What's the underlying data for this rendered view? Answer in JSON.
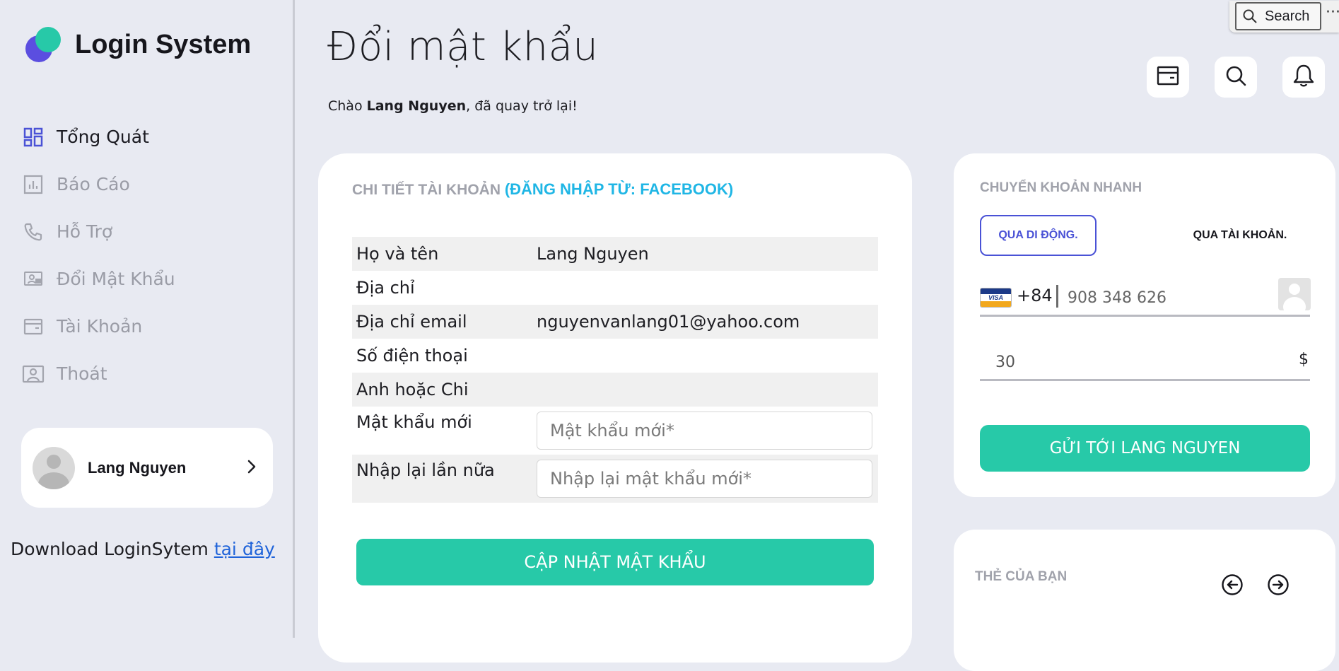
{
  "brand": {
    "name": "Login System"
  },
  "sidebar": {
    "items": [
      {
        "label": "Tổng Quát",
        "icon": "dashboard-icon",
        "active": true
      },
      {
        "label": "Báo Cáo",
        "icon": "report-icon",
        "active": false
      },
      {
        "label": "Hỗ Trợ",
        "icon": "phone-icon",
        "active": false
      },
      {
        "label": "Đổi Mật Khẩu",
        "icon": "change-password-icon",
        "active": false
      },
      {
        "label": "Tài Khoản",
        "icon": "wallet-icon",
        "active": false
      },
      {
        "label": "Thoát",
        "icon": "logout-icon",
        "active": false
      }
    ],
    "profile": {
      "name": "Lang Nguyen"
    },
    "download": {
      "text": "Download LoginSytem ",
      "link": "tại đây"
    }
  },
  "header": {
    "title": "Đổi mật khẩu",
    "welcome_prefix": "Chào ",
    "welcome_name": "Lang Nguyen",
    "welcome_suffix": ", đã quay trở lại!",
    "search": {
      "label": "Search",
      "more": "···"
    }
  },
  "account": {
    "title": "CHI TIẾT TÀI KHOẢN ",
    "source": "(ĐĂNG NHẬP TỪ: FACEBOOK)",
    "rows": [
      {
        "label": "Họ và tên",
        "value": "Lang Nguyen"
      },
      {
        "label": "Địa chỉ",
        "value": ""
      },
      {
        "label": "Địa chỉ email",
        "value": "nguyenvanlang01@yahoo.com"
      },
      {
        "label": "Số điện thoại",
        "value": ""
      },
      {
        "label": "Anh hoặc Chi",
        "value": ""
      }
    ],
    "new_password": {
      "label": "Mật khẩu mới",
      "placeholder": "Mật khẩu mới*"
    },
    "confirm_password": {
      "label": "Nhập lại lần nữa",
      "placeholder": "Nhập lại mật khẩu mới*"
    },
    "update_button": "CẬP NHẬT MẬT KHẨU"
  },
  "transfer": {
    "title": "CHUYỂN KHOẢN NHANH",
    "tab_mobile": "QUA DI ĐỘNG.",
    "tab_account": "QUA TÀI KHOẢN.",
    "card_brand": "VISA",
    "country_code": "+84",
    "phone": "908 348 626",
    "amount": "30",
    "currency": "$",
    "send_button": "GỬI TỚI LANG NGUYEN"
  },
  "cards": {
    "title": "THẺ CỦA BẠN"
  },
  "colors": {
    "accent": "#27c9a8",
    "primary": "#4a52d6",
    "link": "#1f63d9",
    "source": "#1fb6e5",
    "background": "#e8eaf2"
  }
}
